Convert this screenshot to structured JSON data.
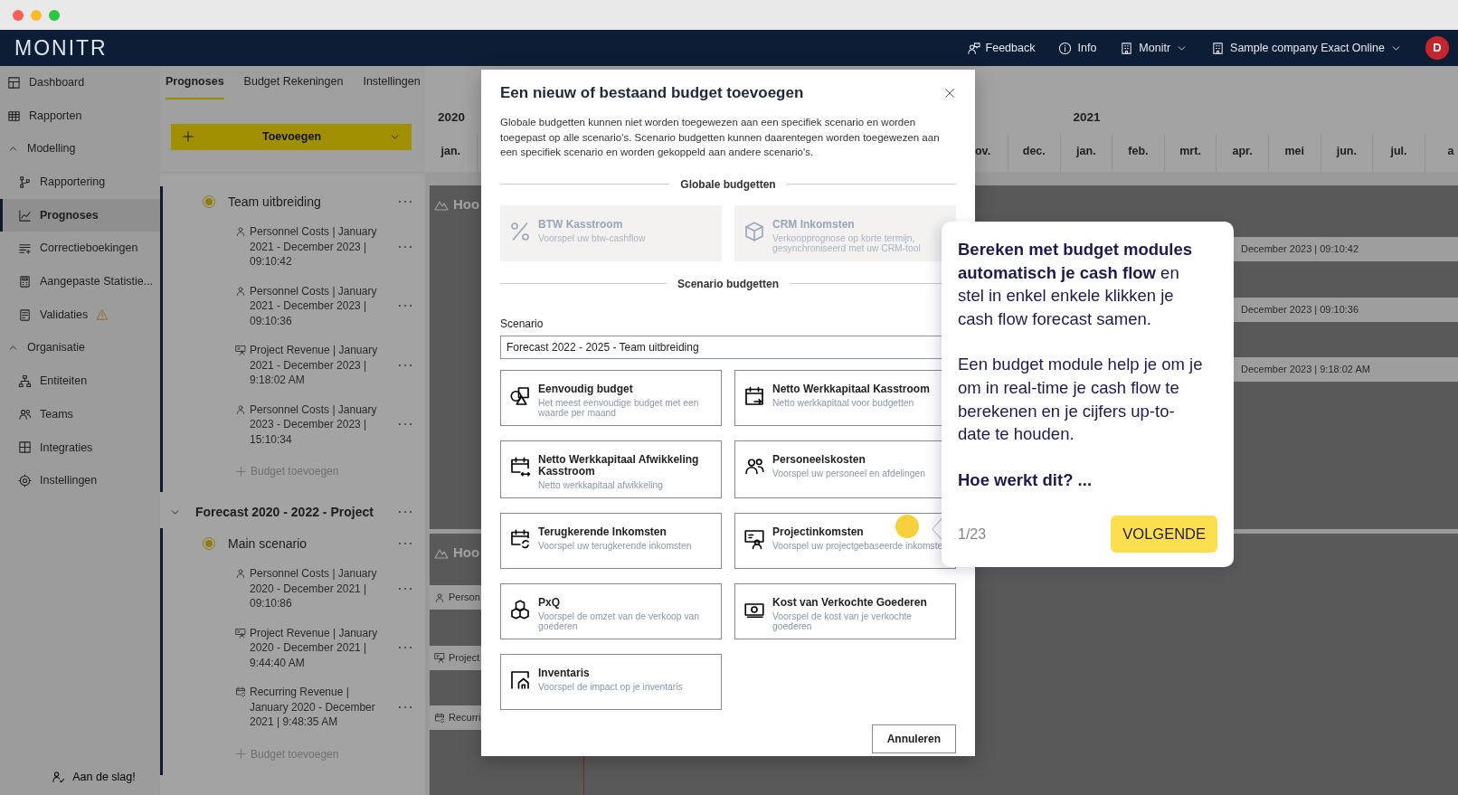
{
  "navbar": {
    "logo": "MONITR",
    "links": [
      {
        "kind": "feedback",
        "label": "Feedback",
        "dropdown": false
      },
      {
        "kind": "info",
        "label": "Info",
        "dropdown": false
      },
      {
        "kind": "workspace",
        "label": "Monitr",
        "dropdown": true
      },
      {
        "kind": "company",
        "label": "Sample company Exact Online",
        "dropdown": true
      }
    ],
    "avatar": "D"
  },
  "sidebar": {
    "items": [
      {
        "label": "Dashboard",
        "selected": false,
        "warning": false
      },
      {
        "label": "Rapporten",
        "selected": false,
        "warning": false
      },
      {
        "label": "Modelling",
        "expanded": true,
        "children": [
          {
            "label": "Rapportering",
            "selected": false,
            "warning": false
          },
          {
            "label": "Prognoses",
            "selected": true,
            "warning": false
          },
          {
            "label": "Correctieboekingen",
            "selected": false,
            "warning": false
          },
          {
            "label": "Aangepaste Statistie...",
            "selected": false,
            "warning": false
          },
          {
            "label": "Validaties",
            "selected": false,
            "warning": true
          }
        ]
      },
      {
        "label": "Organisatie",
        "expanded": true,
        "children": [
          {
            "label": "Entiteiten",
            "selected": false,
            "warning": false
          },
          {
            "label": "Teams",
            "selected": false,
            "warning": false
          },
          {
            "label": "Integraties",
            "selected": false,
            "warning": false
          },
          {
            "label": "Instellingen",
            "selected": false,
            "warning": false
          }
        ]
      }
    ],
    "footer": "Aan de slag!"
  },
  "panel": {
    "tabs": [
      {
        "label": "Prognoses",
        "selected": true
      },
      {
        "label": "Budget Rekeningen",
        "selected": false
      },
      {
        "label": "Instellingen",
        "selected": false
      }
    ],
    "add_button": "Toevoegen",
    "forecasts": [
      {
        "scenarios": [
          {
            "name": "Team uitbreiding",
            "active": true,
            "budgets": [
              {
                "kind": "personnel",
                "label": "Personnel Costs | January 2021 - December 2023 | 09:10:42"
              },
              {
                "kind": "personnel",
                "label": "Personnel Costs | January 2021 - December 2023 | 09:10:36"
              },
              {
                "kind": "project",
                "label": "Project Revenue | January 2021 - December 2023 | 9:18:02 AM"
              },
              {
                "kind": "personnel",
                "label": "Personnel Costs | January 2023 - December 2023 | 15:10:34"
              }
            ],
            "add_label": "Budget toevoegen"
          }
        ]
      },
      {
        "title": "Forecast 2020 - 2022 - Project",
        "expanded": true,
        "scenarios": [
          {
            "name": "Main scenario",
            "active": true,
            "budgets": [
              {
                "kind": "personnel",
                "label": "Personnel Costs | January 2020 - December 2021 | 09:10:86"
              },
              {
                "kind": "project",
                "label": "Project Revenue | January 2020 - December 2021 | 9:44:40 AM"
              },
              {
                "kind": "recurring",
                "label": "Recurring Revenue | January 2020 - December 2021 | 9:48:35 AM"
              }
            ],
            "add_label": "Budget toevoegen"
          }
        ]
      }
    ]
  },
  "timeline": {
    "left": {
      "year": "2020",
      "months": [
        "jan."
      ]
    },
    "right": {
      "lead_months": [
        "ov.",
        "dec."
      ],
      "year": "2021",
      "months": [
        "jan.",
        "feb.",
        "mrt.",
        "apr.",
        "mei",
        "jun.",
        "jul.",
        "a"
      ]
    },
    "groups": [
      {
        "label": "Hoo",
        "bars": [
          {
            "kind": "tail",
            "label": "December 2023 | 09:10:42"
          },
          {
            "kind": "tail",
            "label": "December 2023 | 09:10:36"
          },
          {
            "kind": "tail",
            "label": "December 2023 | 9:18:02 AM"
          }
        ]
      },
      {
        "label": "Hoo",
        "bars": [
          {
            "kind": "personnel",
            "label": "Person"
          },
          {
            "kind": "project",
            "label": "Project"
          },
          {
            "kind": "recurring",
            "label": "Recurri"
          }
        ]
      }
    ]
  },
  "modal": {
    "title": "Een nieuw of bestaand budget toevoegen",
    "description": "Globale budgetten kunnen niet worden toegewezen aan een specifiek scenario en worden toegepast op alle scenario's. Scenario budgetten kunnen daarentegen worden toegewezen aan een specifiek scenario en worden gekoppeld aan andere scenario's.",
    "sections": [
      {
        "heading": "Globale budgetten",
        "cards": [
          {
            "title": "BTW Kasstroom",
            "description": "Voorspel uw btw-cashflow",
            "disabled": true
          },
          {
            "title": "CRM Inkomsten",
            "description": "Verkoopprognose op korte termijn, gesynchroniseerd met uw CRM-tool",
            "disabled": true
          }
        ]
      },
      {
        "heading": "Scenario budgetten",
        "field": {
          "label": "Scenario",
          "value": "Forecast 2022 - 2025 - Team uitbreiding"
        },
        "cards": [
          {
            "title": "Eenvoudig budget",
            "description": "Het meest eenvoudige budget met een waarde per maand",
            "disabled": false
          },
          {
            "title": "Netto Werkkapitaal Kasstroom",
            "description": "Netto werkkapitaal voor budgetten",
            "disabled": false
          },
          {
            "title": "Netto Werkkapitaal Afwikkeling Kasstroom",
            "description": "Netto werkkapitaal afwikkeling",
            "disabled": false
          },
          {
            "title": "Personeelskosten",
            "description": "Voorspel uw personeel en afdelingen",
            "disabled": false
          },
          {
            "title": "Terugkerende Inkomsten",
            "description": "Voorspel uw terugkerende inkomsten",
            "disabled": false
          },
          {
            "title": "Projectinkomsten",
            "description": "Voorspel uw projectgebaseerde inkomste",
            "disabled": false
          },
          {
            "title": "PxQ",
            "description": "Voorspel de omzet van de verkoop van goederen",
            "disabled": false
          },
          {
            "title": "Kost van Verkochte Goederen",
            "description": "Voorspel de kost van je verkochte goederen",
            "disabled": false
          },
          {
            "title": "Inventaris",
            "description": "Voorspel de impact op je inventaris",
            "disabled": false
          }
        ]
      }
    ],
    "cancel": "Annuleren"
  },
  "tour": {
    "paragraphs": [
      "**Bereken met budget modules automatisch je cash flow** en stel in enkel enkele klikken je cash flow forecast samen.",
      "Een budget module help je om je om in real-time je cash flow te berekenen en je cijfers up-to-date te houden."
    ],
    "question": "Hoe werkt dit? ...",
    "step": "1/23",
    "next": "VOLGENDE"
  }
}
